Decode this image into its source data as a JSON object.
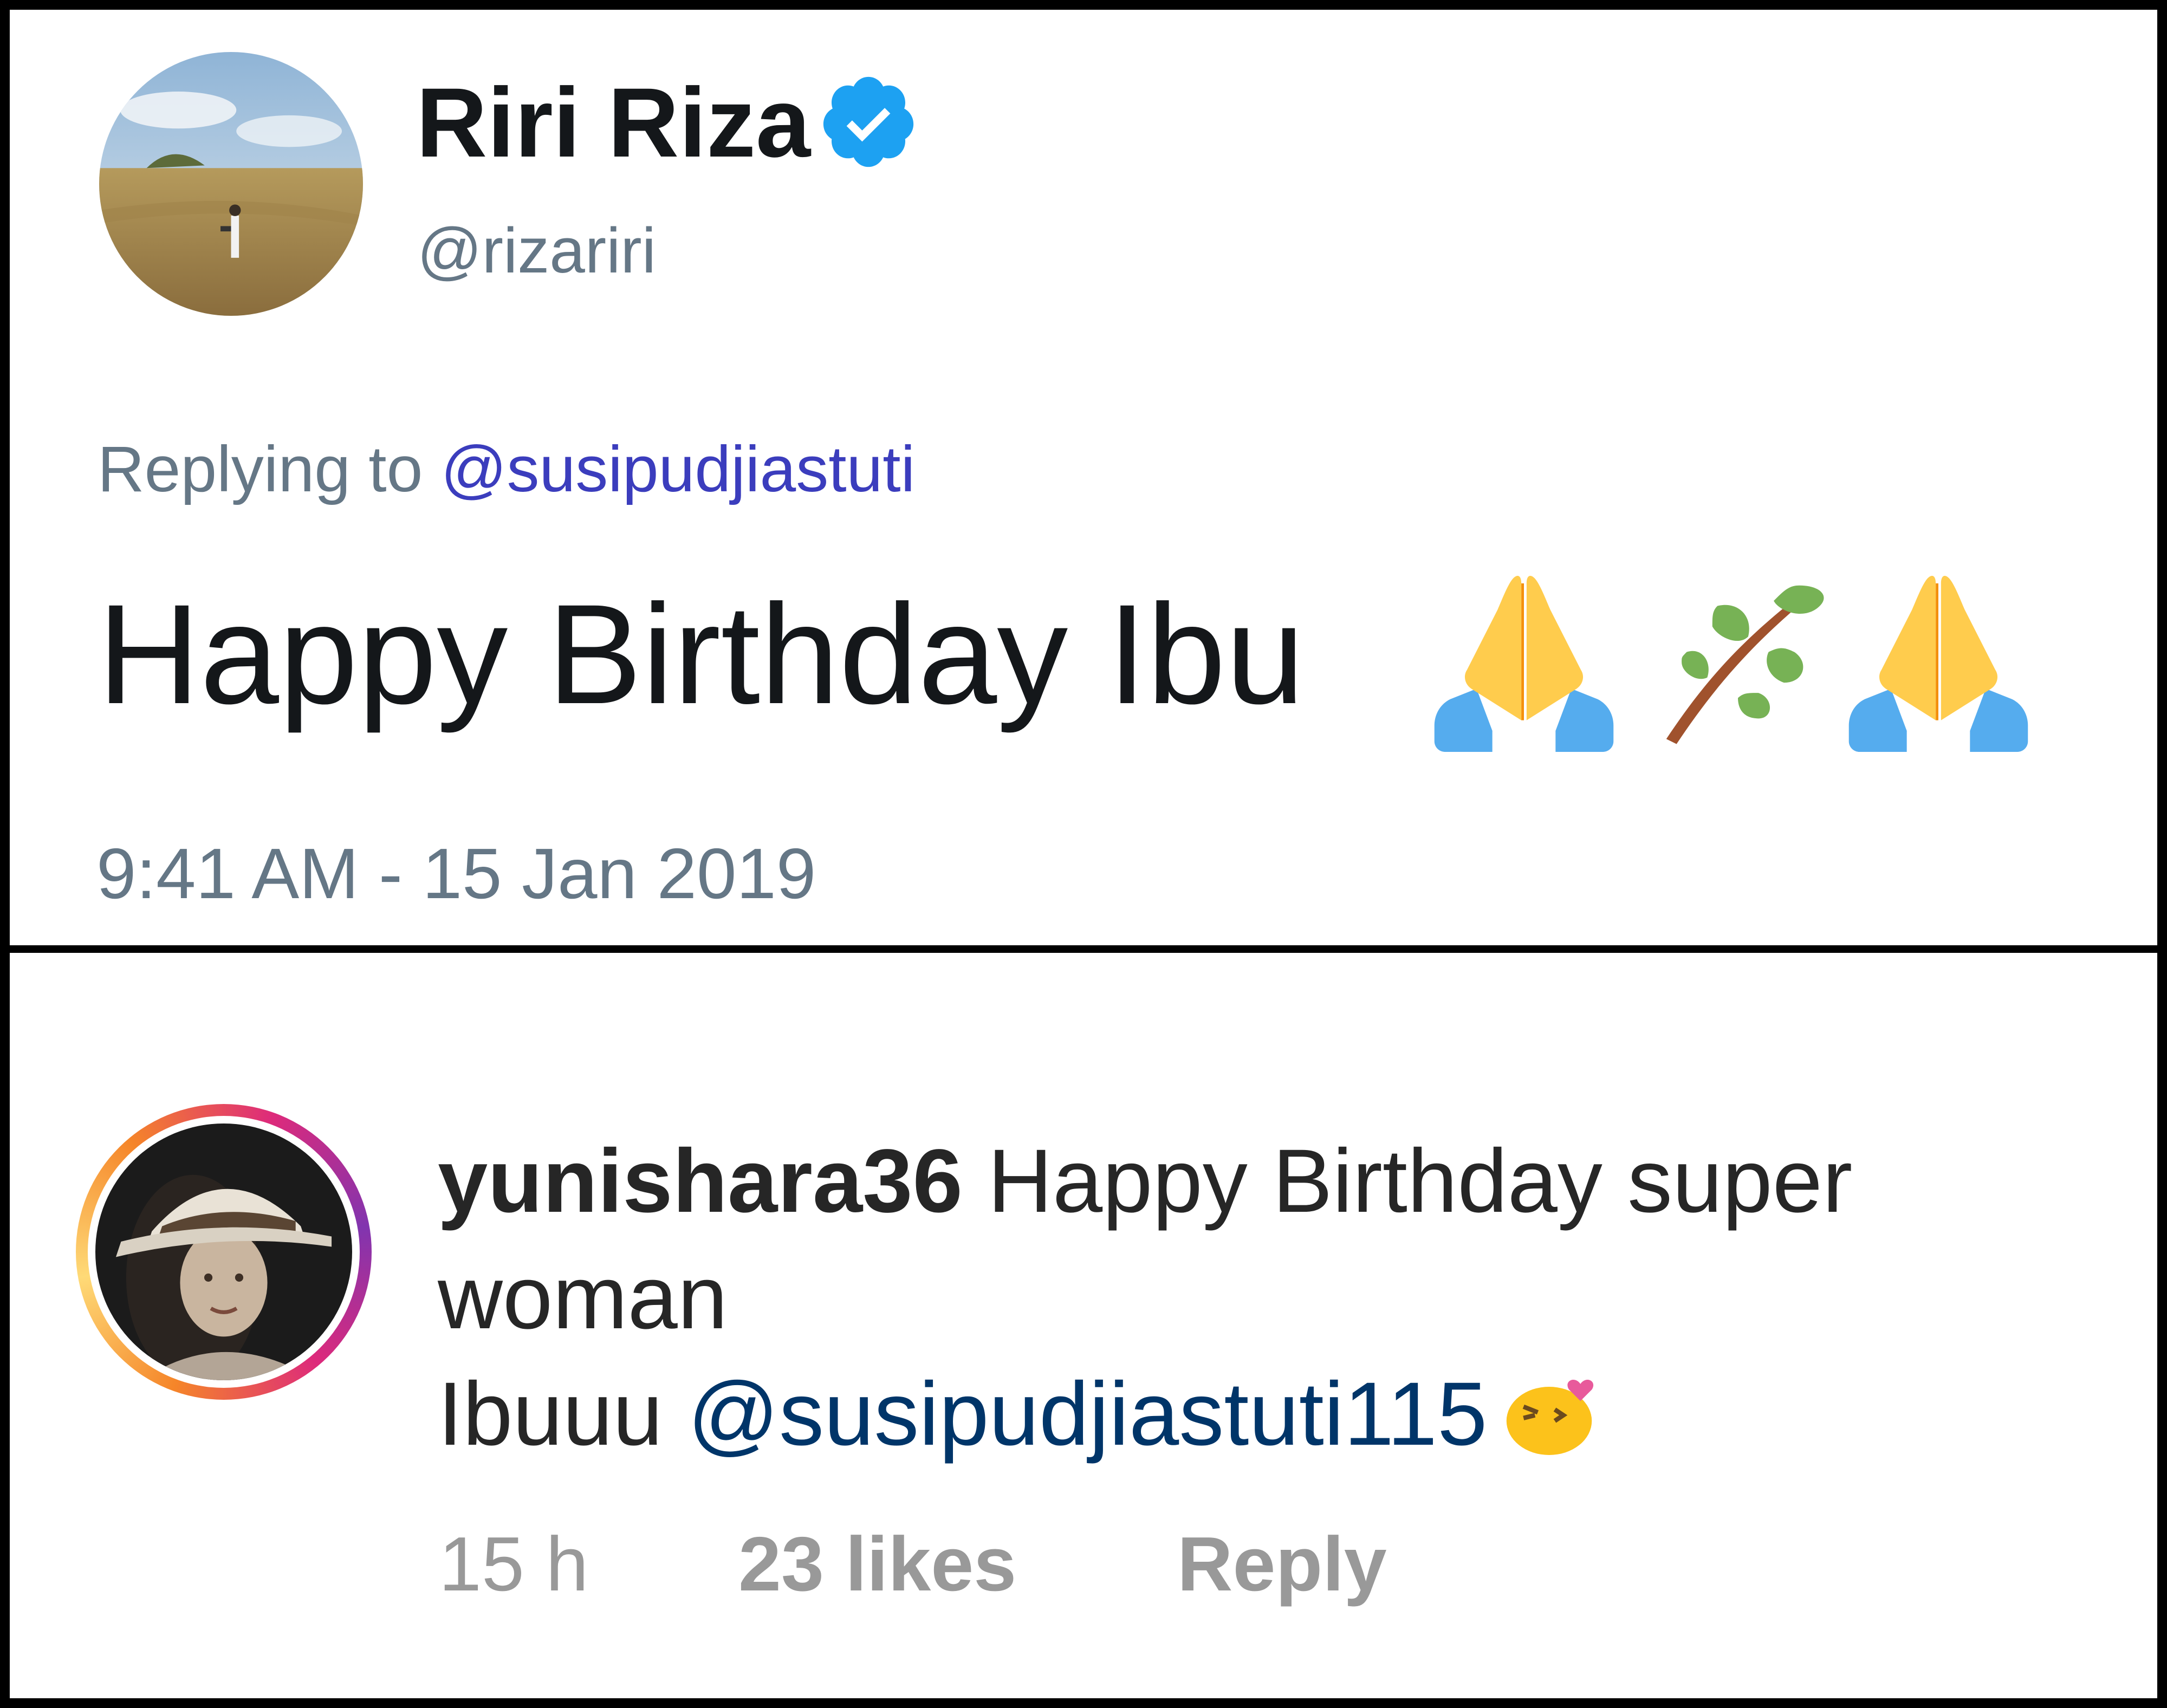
{
  "tweet": {
    "display_name": "Riri Riza",
    "verified_icon": "verified-badge-icon",
    "handle": "@rizariri",
    "replying_prefix": "Replying to",
    "replying_mention": "@susipudjiastuti",
    "text": "Happy Birthday Ibu",
    "emojis": [
      "folded-hands-icon",
      "herb-icon",
      "folded-hands-icon"
    ],
    "timestamp": "9:41 AM - 15 Jan 2019"
  },
  "comment": {
    "username": "yunishara36",
    "text_line1": "Happy Birthday super",
    "text_line2": "woman",
    "text_line3_prefix": "Ibuuu",
    "mention": "@susipudjiastuti115",
    "emoji": "kissing-face-heart-icon",
    "time_ago": "15 h",
    "likes": "23 likes",
    "reply_label": "Reply"
  },
  "colors": {
    "border": "#000000",
    "twitter_blue": "#1da1f2",
    "twitter_gray": "#657786",
    "mention_purple": "#3b3dbd",
    "ig_mention": "#003569",
    "ig_meta_gray": "#999999"
  }
}
